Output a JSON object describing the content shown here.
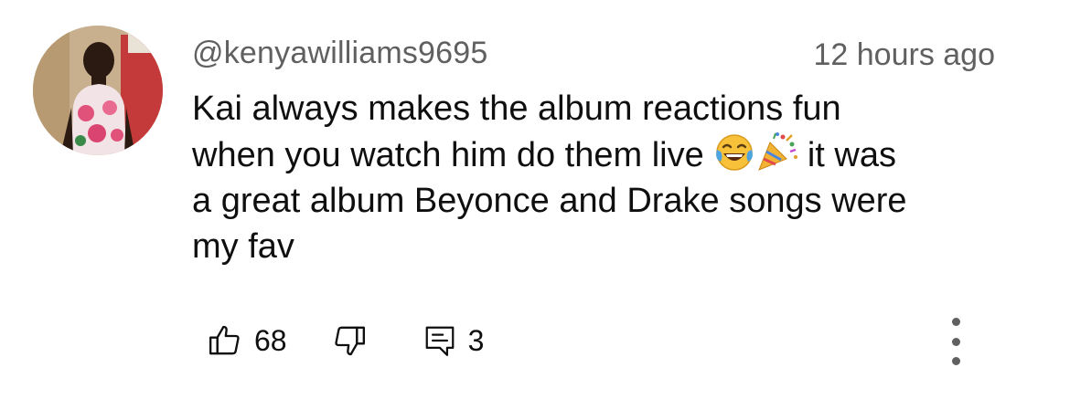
{
  "comment": {
    "author": "@kenyawilliams9695",
    "timestamp": "12 hours ago",
    "text_line1": "Kai always makes the album reactions fun",
    "text_line2_before": "when you watch him do them live ",
    "text_line2_after": " it was",
    "text_line3": "a great album Beyonce and Drake songs were",
    "text_line4": "my fav",
    "emojis": [
      "face-with-tears-of-joy",
      "party-popper"
    ]
  },
  "actions": {
    "like_count": "68",
    "reply_count": "3",
    "icons": [
      "thumbs-up-icon",
      "thumbs-down-icon",
      "reply-icon",
      "more-vertical-icon"
    ]
  },
  "colors": {
    "text": "#0f0f0f",
    "secondary": "#606060",
    "background": "#ffffff"
  }
}
